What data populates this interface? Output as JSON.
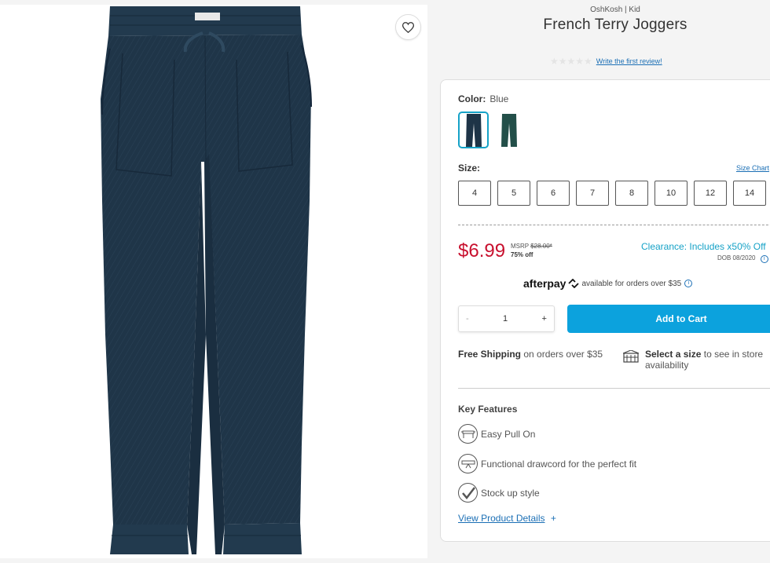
{
  "product": {
    "brand": "OshKosh | Kid",
    "title": "French Terry Joggers",
    "review_link": "Write the first review!",
    "stars": "★★★★★"
  },
  "color": {
    "label": "Color:",
    "value": "Blue",
    "swatches": [
      {
        "name": "Blue",
        "hex": "#1e3447",
        "selected": true
      },
      {
        "name": "Green",
        "hex": "#234f49",
        "selected": false
      }
    ]
  },
  "size": {
    "label": "Size:",
    "chart_link": "Size Chart",
    "options": [
      "4",
      "5",
      "6",
      "7",
      "8",
      "10",
      "12",
      "14"
    ]
  },
  "pricing": {
    "price": "$6.99",
    "msrp_label": "MSRP",
    "msrp_value": "$28.00*",
    "discount": "75% off",
    "clearance": "Clearance: Includes x50% Off",
    "dob": "DOB 08/2020"
  },
  "afterpay": {
    "logo": "afterpay",
    "text": "available for orders over $35",
    "info": "i"
  },
  "quantity": {
    "minus": "-",
    "value": "1",
    "plus": "+"
  },
  "cart": {
    "label": "Add to Cart"
  },
  "shipping": {
    "bold": "Free Shipping",
    "rest": "on orders over $35"
  },
  "store": {
    "bold": "Select a size",
    "rest": "to see in store availability"
  },
  "features": {
    "title": "Key Features",
    "items": [
      {
        "label": "Easy Pull On",
        "icon": "pull-on-icon"
      },
      {
        "label": "Functional drawcord for the perfect fit",
        "icon": "drawcord-icon"
      },
      {
        "label": "Stock up style",
        "icon": "checkmark-icon"
      }
    ],
    "details_link": "View Product Details",
    "details_plus": "+"
  },
  "colors": {
    "price_red": "#c8102e",
    "accent_blue": "#16a2c7",
    "button_blue": "#0ca2dd",
    "pants_navy": "#1e3447"
  }
}
